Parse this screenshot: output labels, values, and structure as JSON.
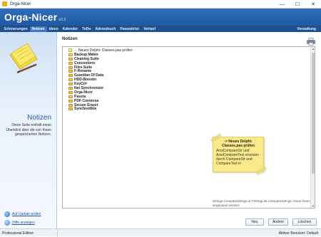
{
  "window": {
    "title": "Orga-Nicer",
    "minimize": "—",
    "maximize": "☐",
    "close": "✕"
  },
  "header": {
    "app_name": "Orga-Nicer",
    "version": "v3.2"
  },
  "menu": {
    "items": [
      "Erinnerungen",
      "Notizen",
      "Ideen",
      "Kalender",
      "ToDo",
      "Adressbuch",
      "Passwörter",
      "Verlauf"
    ],
    "active": "Notizen",
    "right": "Verwaltung"
  },
  "sidebar": {
    "title": "Notizen",
    "description": "Diese Seite enthält einen Überblick über die von Ihnen gespeicherten Notizen.",
    "links": [
      {
        "label": "Auf Update prüfen",
        "icon": "globe-icon"
      },
      {
        "label": "Hilfe anzeigen",
        "icon": "help-icon"
      }
    ]
  },
  "content": {
    "title": "Notizen",
    "tree": {
      "first": "Neues Delphi: Classes.pas prüfen",
      "folders": [
        "Backup Maker",
        "Cleaning Suite",
        "Concentorio",
        "Files Suite",
        "F-Rename",
        "Guardian Of Data",
        "HDD-Booster",
        "KeyCtrl",
        "Net Synchronizer",
        "Orga-Nicer",
        "Passta",
        "PDF Conversa",
        "Secure Eraser",
        "Synchredible"
      ]
    },
    "sticky": {
      "title": "-> Neues Delphi: Classes.pas prüfen",
      "body": "AnsiCompareStr und AnsiCompareText ersetzen durch CompareStr und CompareText in"
    },
    "info_text": "Strings.CompareStrings & TStringList.CompareStrings. Neue ihnen angepasst werden."
  },
  "buttons": {
    "new": "Neu",
    "edit": "Ändern",
    "delete": "Löschen"
  },
  "status": {
    "edition": "Professional Edition",
    "user": "Aktiver Benutzer: Default"
  },
  "colors": {
    "header": "#1f5aa3",
    "menubar": "#1e4f8f",
    "accent_link": "#1f5aa3",
    "sticky": "#fbe98a"
  }
}
